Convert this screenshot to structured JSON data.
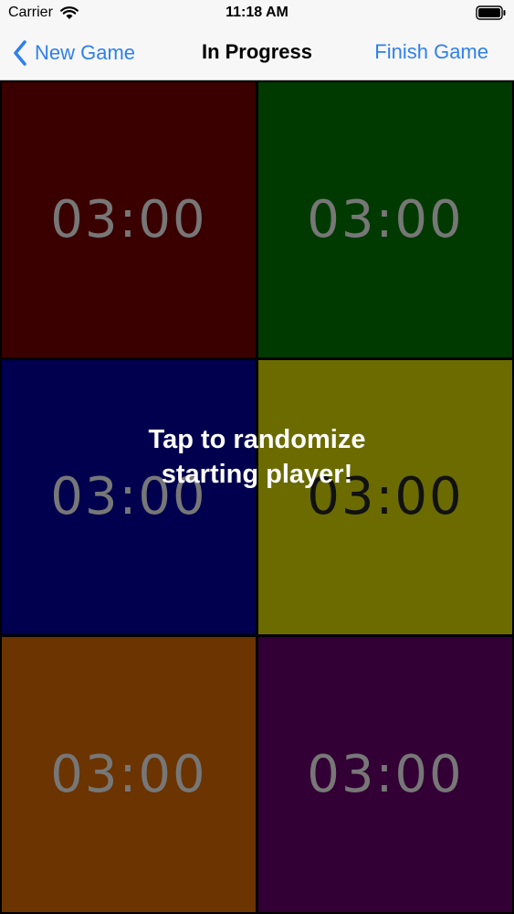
{
  "status_bar": {
    "carrier": "Carrier",
    "time": "11:18 AM"
  },
  "nav": {
    "back_label": "New Game",
    "title": "In Progress",
    "finish_label": "Finish Game"
  },
  "colors": {
    "accent": "#2f80ed",
    "nav_background": "#f7f7f7"
  },
  "tiles": [
    {
      "timer": "03:00",
      "color": "#3a0000"
    },
    {
      "timer": "03:00",
      "color": "#003a00"
    },
    {
      "timer": "03:00",
      "color": "#00004e"
    },
    {
      "timer": "03:00",
      "color": "#6b6b00"
    },
    {
      "timer": "03:00",
      "color": "#6b3400"
    },
    {
      "timer": "03:00",
      "color": "#320034"
    }
  ],
  "overlay": {
    "line1": "Tap to randomize",
    "line2": "starting player!"
  }
}
